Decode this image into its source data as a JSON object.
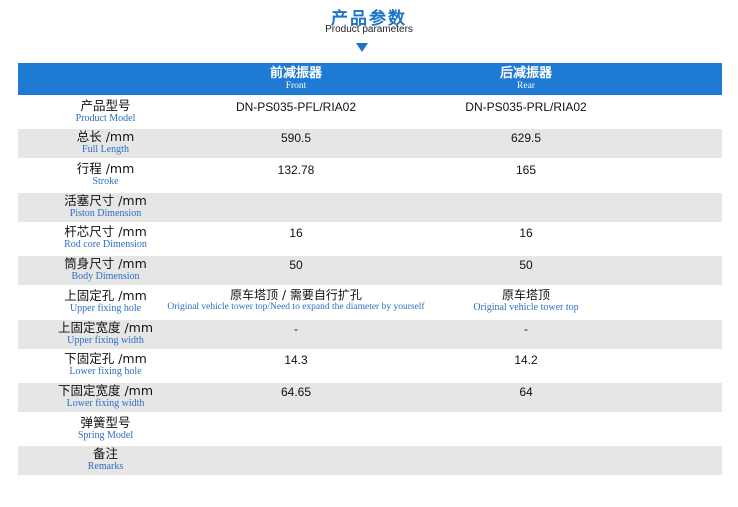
{
  "title": {
    "zh": "产品参数",
    "en": "Product parameters"
  },
  "columns": {
    "front": {
      "zh": "前减振器",
      "en": "Front"
    },
    "rear": {
      "zh": "后减振器",
      "en": "Rear"
    }
  },
  "rows": [
    {
      "zh": "产品型号",
      "en": "Product Model",
      "front": "DN-PS035-PFL/RIA02",
      "rear": "DN-PS035-PRL/RIA02"
    },
    {
      "zh": "总长 /mm",
      "en": "Full Length",
      "front": "590.5",
      "rear": "629.5"
    },
    {
      "zh": "行程 /mm",
      "en": "Stroke",
      "front": "132.78",
      "rear": "165"
    },
    {
      "zh": "活塞尺寸 /mm",
      "en": "Piston Dimension",
      "front": "",
      "rear": ""
    },
    {
      "zh": "杆芯尺寸 /mm",
      "en": "Rod core Dimension",
      "front": "16",
      "rear": "16"
    },
    {
      "zh": "筒身尺寸 /mm",
      "en": "Body Dimension",
      "front": "50",
      "rear": "50"
    },
    {
      "zh": "上固定孔 /mm",
      "en": "Upper fixing hole",
      "front_zh": "原车塔顶 / 需要自行扩孔",
      "front_en": "Original vehicle tower top/Need to expand the diameter by yourself",
      "rear_zh": "原车塔顶",
      "rear_en": "Original vehicle tower top"
    },
    {
      "zh": "上固定宽度 /mm",
      "en": "Upper fixing width",
      "front": "-",
      "rear": "-"
    },
    {
      "zh": "下固定孔 /mm",
      "en": "Lower fixing hole",
      "front": "14.3",
      "rear": "14.2"
    },
    {
      "zh": "下固定宽度 /mm",
      "en": "Lower fixing width",
      "front": "64.65",
      "rear": "64"
    },
    {
      "zh": "弹簧型号",
      "en": "Spring Model",
      "front": "",
      "rear": ""
    },
    {
      "zh": "备注",
      "en": "Remarks",
      "front": "",
      "rear": ""
    }
  ]
}
